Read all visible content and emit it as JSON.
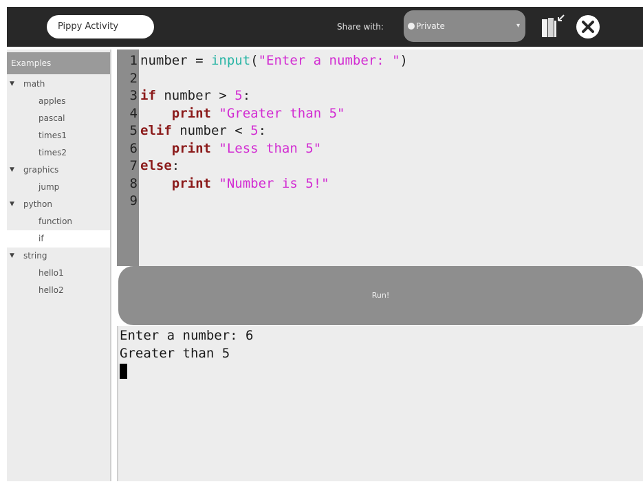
{
  "toolbar": {
    "activity_title": "Pippy Activity",
    "share_label": "Share with:",
    "share_value": "Private",
    "share_arrow": "▾"
  },
  "sidebar": {
    "header": "Examples",
    "tree": [
      {
        "label": "math",
        "type": "category"
      },
      {
        "label": "apples",
        "type": "leaf"
      },
      {
        "label": "pascal",
        "type": "leaf"
      },
      {
        "label": "times1",
        "type": "leaf"
      },
      {
        "label": "times2",
        "type": "leaf"
      },
      {
        "label": "graphics",
        "type": "category"
      },
      {
        "label": "jump",
        "type": "leaf"
      },
      {
        "label": "python",
        "type": "category"
      },
      {
        "label": "function",
        "type": "leaf"
      },
      {
        "label": "if",
        "type": "leaf",
        "selected": true
      },
      {
        "label": "string",
        "type": "category"
      },
      {
        "label": "hello1",
        "type": "leaf"
      },
      {
        "label": "hello2",
        "type": "leaf"
      }
    ]
  },
  "editor": {
    "line_numbers": [
      "1",
      "2",
      "3",
      "4",
      "5",
      "6",
      "7",
      "8",
      "9"
    ],
    "lines": [
      [
        {
          "t": "number = ",
          "c": "op"
        },
        {
          "t": "input",
          "c": "builtin"
        },
        {
          "t": "(",
          "c": "op"
        },
        {
          "t": "\"Enter a number: \"",
          "c": "str"
        },
        {
          "t": ")",
          "c": "op"
        }
      ],
      [],
      [
        {
          "t": "if",
          "c": "kw"
        },
        {
          "t": " number > ",
          "c": "op"
        },
        {
          "t": "5",
          "c": "num"
        },
        {
          "t": ":",
          "c": "op"
        }
      ],
      [
        {
          "t": "    ",
          "c": "op"
        },
        {
          "t": "print",
          "c": "kw"
        },
        {
          "t": " ",
          "c": "op"
        },
        {
          "t": "\"Greater than 5\"",
          "c": "str"
        }
      ],
      [
        {
          "t": "elif",
          "c": "kw"
        },
        {
          "t": " number < ",
          "c": "op"
        },
        {
          "t": "5",
          "c": "num"
        },
        {
          "t": ":",
          "c": "op"
        }
      ],
      [
        {
          "t": "    ",
          "c": "op"
        },
        {
          "t": "print",
          "c": "kw"
        },
        {
          "t": " ",
          "c": "op"
        },
        {
          "t": "\"Less than 5\"",
          "c": "str"
        }
      ],
      [
        {
          "t": "else",
          "c": "kw"
        },
        {
          "t": ":",
          "c": "op"
        }
      ],
      [
        {
          "t": "    ",
          "c": "op"
        },
        {
          "t": "print",
          "c": "kw"
        },
        {
          "t": " ",
          "c": "op"
        },
        {
          "t": "\"Number is 5!\"",
          "c": "str"
        }
      ],
      []
    ]
  },
  "run_button": {
    "label": "Run!"
  },
  "output": {
    "lines": [
      "Enter a number: 6",
      "Greater than 5"
    ]
  },
  "icons": {
    "keep": "keep-journal-icon",
    "stop": "stop-icon",
    "expand": "expand-triangle-icon"
  }
}
